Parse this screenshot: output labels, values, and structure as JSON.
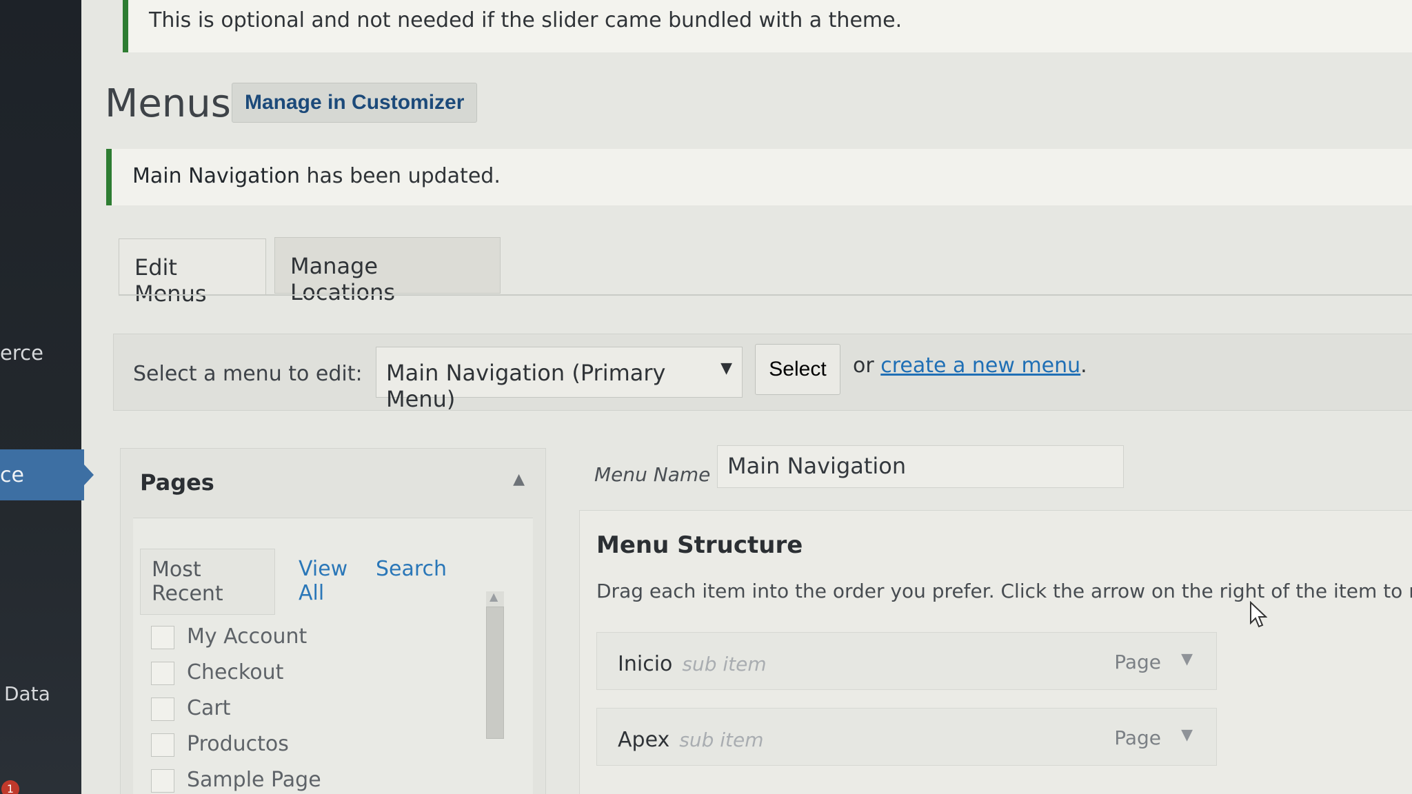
{
  "sidebar": {
    "items": [
      {
        "label": "erce"
      },
      {
        "label": "ce"
      },
      {
        "label": "Data"
      }
    ],
    "badge": "1"
  },
  "notice_top": "This is optional and not needed if the slider came bundled with a theme.",
  "header": {
    "title": "Menus",
    "customizer_button": "Manage in Customizer"
  },
  "notice_updated": {
    "menu_name": "Main Navigation",
    "message": " has been updated."
  },
  "tabs": [
    {
      "label": "Edit Menus",
      "active": true
    },
    {
      "label": "Manage Locations",
      "active": false
    }
  ],
  "select_bar": {
    "label": "Select a menu to edit:",
    "selected_menu": "Main Navigation (Primary Menu)",
    "select_button": "Select",
    "or_text": "or ",
    "create_link": "create a new menu",
    "period": "."
  },
  "pages_box": {
    "title": "Pages",
    "sub_tabs": [
      "Most Recent",
      "View All",
      "Search"
    ],
    "items": [
      "My Account",
      "Checkout",
      "Cart",
      "Productos",
      "Sample Page"
    ]
  },
  "menu_name": {
    "label": "Menu Name",
    "value": "Main Navigation"
  },
  "structure": {
    "title": "Menu Structure",
    "description": "Drag each item into the order you prefer. Click the arrow on the right of the item to reveal",
    "items": [
      {
        "title": "Inicio",
        "sub": "sub item",
        "type": "Page"
      },
      {
        "title": "Apex",
        "sub": "sub item",
        "type": "Page"
      }
    ]
  },
  "colors": {
    "sidebar_active": "#3d6fa3",
    "notice_border": "#2e7d32",
    "link": "#1f6fb5"
  }
}
